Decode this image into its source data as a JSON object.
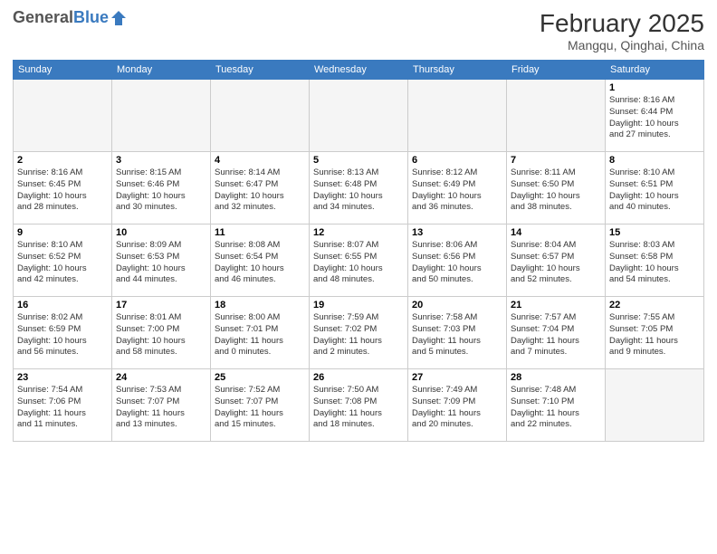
{
  "header": {
    "logo_general": "General",
    "logo_blue": "Blue",
    "month_title": "February 2025",
    "subtitle": "Mangqu, Qinghai, China"
  },
  "days_of_week": [
    "Sunday",
    "Monday",
    "Tuesday",
    "Wednesday",
    "Thursday",
    "Friday",
    "Saturday"
  ],
  "weeks": [
    [
      {
        "num": "",
        "info": ""
      },
      {
        "num": "",
        "info": ""
      },
      {
        "num": "",
        "info": ""
      },
      {
        "num": "",
        "info": ""
      },
      {
        "num": "",
        "info": ""
      },
      {
        "num": "",
        "info": ""
      },
      {
        "num": "1",
        "info": "Sunrise: 8:16 AM\nSunset: 6:44 PM\nDaylight: 10 hours\nand 27 minutes."
      }
    ],
    [
      {
        "num": "2",
        "info": "Sunrise: 8:16 AM\nSunset: 6:45 PM\nDaylight: 10 hours\nand 28 minutes."
      },
      {
        "num": "3",
        "info": "Sunrise: 8:15 AM\nSunset: 6:46 PM\nDaylight: 10 hours\nand 30 minutes."
      },
      {
        "num": "4",
        "info": "Sunrise: 8:14 AM\nSunset: 6:47 PM\nDaylight: 10 hours\nand 32 minutes."
      },
      {
        "num": "5",
        "info": "Sunrise: 8:13 AM\nSunset: 6:48 PM\nDaylight: 10 hours\nand 34 minutes."
      },
      {
        "num": "6",
        "info": "Sunrise: 8:12 AM\nSunset: 6:49 PM\nDaylight: 10 hours\nand 36 minutes."
      },
      {
        "num": "7",
        "info": "Sunrise: 8:11 AM\nSunset: 6:50 PM\nDaylight: 10 hours\nand 38 minutes."
      },
      {
        "num": "8",
        "info": "Sunrise: 8:10 AM\nSunset: 6:51 PM\nDaylight: 10 hours\nand 40 minutes."
      }
    ],
    [
      {
        "num": "9",
        "info": "Sunrise: 8:10 AM\nSunset: 6:52 PM\nDaylight: 10 hours\nand 42 minutes."
      },
      {
        "num": "10",
        "info": "Sunrise: 8:09 AM\nSunset: 6:53 PM\nDaylight: 10 hours\nand 44 minutes."
      },
      {
        "num": "11",
        "info": "Sunrise: 8:08 AM\nSunset: 6:54 PM\nDaylight: 10 hours\nand 46 minutes."
      },
      {
        "num": "12",
        "info": "Sunrise: 8:07 AM\nSunset: 6:55 PM\nDaylight: 10 hours\nand 48 minutes."
      },
      {
        "num": "13",
        "info": "Sunrise: 8:06 AM\nSunset: 6:56 PM\nDaylight: 10 hours\nand 50 minutes."
      },
      {
        "num": "14",
        "info": "Sunrise: 8:04 AM\nSunset: 6:57 PM\nDaylight: 10 hours\nand 52 minutes."
      },
      {
        "num": "15",
        "info": "Sunrise: 8:03 AM\nSunset: 6:58 PM\nDaylight: 10 hours\nand 54 minutes."
      }
    ],
    [
      {
        "num": "16",
        "info": "Sunrise: 8:02 AM\nSunset: 6:59 PM\nDaylight: 10 hours\nand 56 minutes."
      },
      {
        "num": "17",
        "info": "Sunrise: 8:01 AM\nSunset: 7:00 PM\nDaylight: 10 hours\nand 58 minutes."
      },
      {
        "num": "18",
        "info": "Sunrise: 8:00 AM\nSunset: 7:01 PM\nDaylight: 11 hours\nand 0 minutes."
      },
      {
        "num": "19",
        "info": "Sunrise: 7:59 AM\nSunset: 7:02 PM\nDaylight: 11 hours\nand 2 minutes."
      },
      {
        "num": "20",
        "info": "Sunrise: 7:58 AM\nSunset: 7:03 PM\nDaylight: 11 hours\nand 5 minutes."
      },
      {
        "num": "21",
        "info": "Sunrise: 7:57 AM\nSunset: 7:04 PM\nDaylight: 11 hours\nand 7 minutes."
      },
      {
        "num": "22",
        "info": "Sunrise: 7:55 AM\nSunset: 7:05 PM\nDaylight: 11 hours\nand 9 minutes."
      }
    ],
    [
      {
        "num": "23",
        "info": "Sunrise: 7:54 AM\nSunset: 7:06 PM\nDaylight: 11 hours\nand 11 minutes."
      },
      {
        "num": "24",
        "info": "Sunrise: 7:53 AM\nSunset: 7:07 PM\nDaylight: 11 hours\nand 13 minutes."
      },
      {
        "num": "25",
        "info": "Sunrise: 7:52 AM\nSunset: 7:07 PM\nDaylight: 11 hours\nand 15 minutes."
      },
      {
        "num": "26",
        "info": "Sunrise: 7:50 AM\nSunset: 7:08 PM\nDaylight: 11 hours\nand 18 minutes."
      },
      {
        "num": "27",
        "info": "Sunrise: 7:49 AM\nSunset: 7:09 PM\nDaylight: 11 hours\nand 20 minutes."
      },
      {
        "num": "28",
        "info": "Sunrise: 7:48 AM\nSunset: 7:10 PM\nDaylight: 11 hours\nand 22 minutes."
      },
      {
        "num": "",
        "info": ""
      }
    ]
  ]
}
